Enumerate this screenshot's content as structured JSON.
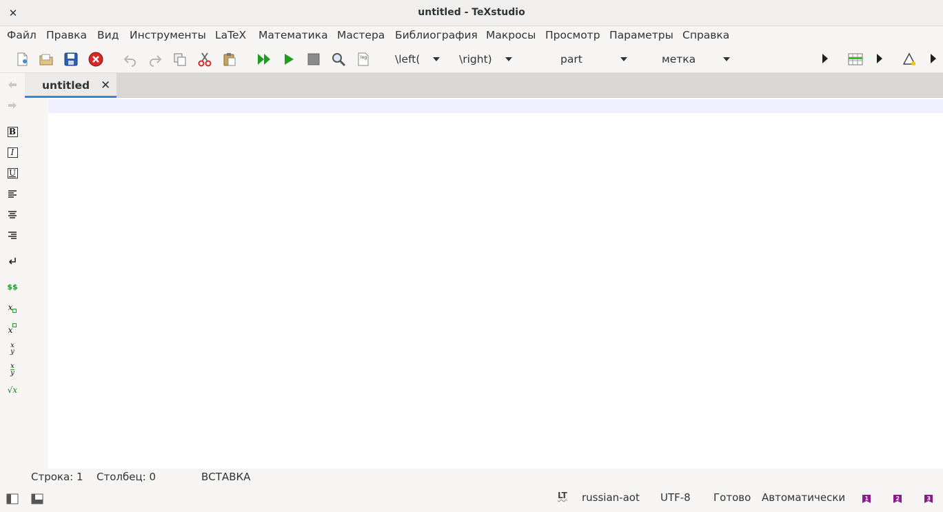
{
  "window": {
    "title": "untitled - TeXstudio",
    "close_glyph": "✕"
  },
  "menu": [
    "Файл",
    "Правка",
    "Вид",
    "Инструменты",
    "LaTeX",
    "Математика",
    "Мастера",
    "Библиография",
    "Макросы",
    "Просмотр",
    "Параметры",
    "Справка"
  ],
  "toolbar": {
    "icons": [
      "new-file-icon",
      "open-file-icon",
      "save-icon",
      "close-document-icon",
      "undo-icon",
      "redo-icon",
      "copy-icon",
      "cut-icon",
      "paste-icon",
      "build-and-view-icon",
      "compile-icon",
      "stop-icon",
      "view-pdf-icon",
      "view-log-icon"
    ],
    "combo_left": "\\left(",
    "combo_right": "\\right)",
    "combo_section": "part",
    "combo_label": "метка"
  },
  "left_panel": {
    "bold": "B",
    "italic": "I",
    "underline": "U",
    "math_inline": "$$",
    "subscript_base": "x",
    "superscript_base": "x",
    "fraction_num": "x",
    "fraction_den": "y",
    "dfrac_num": "x",
    "dfrac_den": "y",
    "sqrt": "√x"
  },
  "tab": {
    "label": "untitled",
    "close": "✕"
  },
  "status": {
    "line_label": "Строка: 1",
    "column_label": "Столбец: 0",
    "mode": "ВСТАВКА",
    "lt_badge": "LT",
    "language": "russian-aot",
    "encoding": "UTF-8",
    "ready": "Готово",
    "auto": "Автоматически",
    "bookmarks": [
      "1",
      "2",
      "3"
    ]
  },
  "colors": {
    "accent": "#3584e4",
    "current_line": "#efeffd",
    "run_green": "#1f9d1f",
    "close_red": "#d62828",
    "bookmark_purple": "#8b1a8b"
  }
}
